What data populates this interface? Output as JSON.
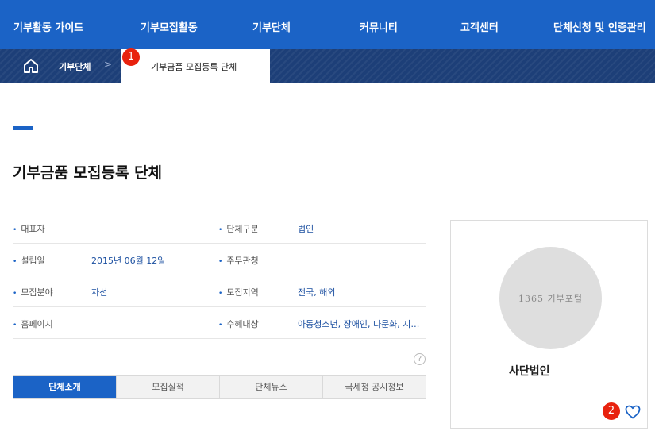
{
  "nav": {
    "items": [
      "기부활동 가이드",
      "기부모집활동",
      "기부단체",
      "커뮤니티",
      "고객센터",
      "단체신청 및 인증관리"
    ]
  },
  "breadcrumb": {
    "parent": "기부단체",
    "separator": ">",
    "current": "기부금품 모집등록 단체",
    "badge1": "1"
  },
  "page": {
    "title": "기부금품 모집등록 단체"
  },
  "info": {
    "rows": [
      {
        "left_label": "대표자",
        "left_value": "",
        "right_label": "단체구분",
        "right_value": "법인"
      },
      {
        "left_label": "설립일",
        "left_value": "2015년 06월 12일",
        "right_label": "주무관청",
        "right_value": ""
      },
      {
        "left_label": "모집분야",
        "left_value": "자선",
        "right_label": "모집지역",
        "right_value": "전국, 해외"
      },
      {
        "left_label": "홈페이지",
        "left_value": "",
        "right_label": "수혜대상",
        "right_value": "아동청소년, 장애인, 다문화, 지…"
      }
    ],
    "help_glyph": "?"
  },
  "tabs": [
    "단체소개",
    "모집실적",
    "단체뉴스",
    "국세청 공시정보"
  ],
  "profile": {
    "logo_text": "1365 기부포털",
    "org_type": "사단법인",
    "badge2": "2",
    "favorite_icon": "heart-outline-icon"
  },
  "colors": {
    "primary": "#1b63c6",
    "breadcrumb_bg": "#1d3f78",
    "badge": "#e8220e"
  }
}
